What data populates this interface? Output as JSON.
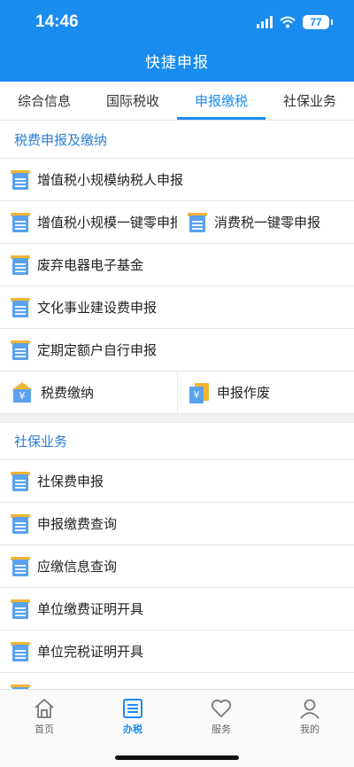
{
  "status": {
    "time": "14:46",
    "battery": "77"
  },
  "header": {
    "title": "快捷申报"
  },
  "tabs": [
    {
      "label": "综合信息"
    },
    {
      "label": "国际税收"
    },
    {
      "label": "申报缴税"
    },
    {
      "label": "社保业务"
    }
  ],
  "tax_section": {
    "title": "税费申报及缴纳",
    "items": [
      {
        "label": "增值税小规模纳税人申报"
      },
      {
        "label": "增值税小规模一键零申报"
      },
      {
        "label": "消费税一键零申报"
      },
      {
        "label": "废弃电器电子基金"
      },
      {
        "label": "文化事业建设费申报"
      },
      {
        "label": "定期定额户自行申报"
      },
      {
        "label": "税费缴纳"
      },
      {
        "label": "申报作废"
      }
    ]
  },
  "social_section": {
    "title": "社保业务",
    "items": [
      {
        "label": "社保费申报"
      },
      {
        "label": "申报缴费查询"
      },
      {
        "label": "应缴信息查询"
      },
      {
        "label": "单位缴费证明开具"
      },
      {
        "label": "单位完税证明开具"
      }
    ]
  },
  "tabbar": [
    {
      "label": "首页"
    },
    {
      "label": "办税"
    },
    {
      "label": "服务"
    },
    {
      "label": "我的"
    }
  ],
  "colors": {
    "primary": "#1a8cf0",
    "section_title": "#2c7fd4",
    "icon_blue": "#5aa2ee",
    "icon_gold": "#f2b531"
  }
}
